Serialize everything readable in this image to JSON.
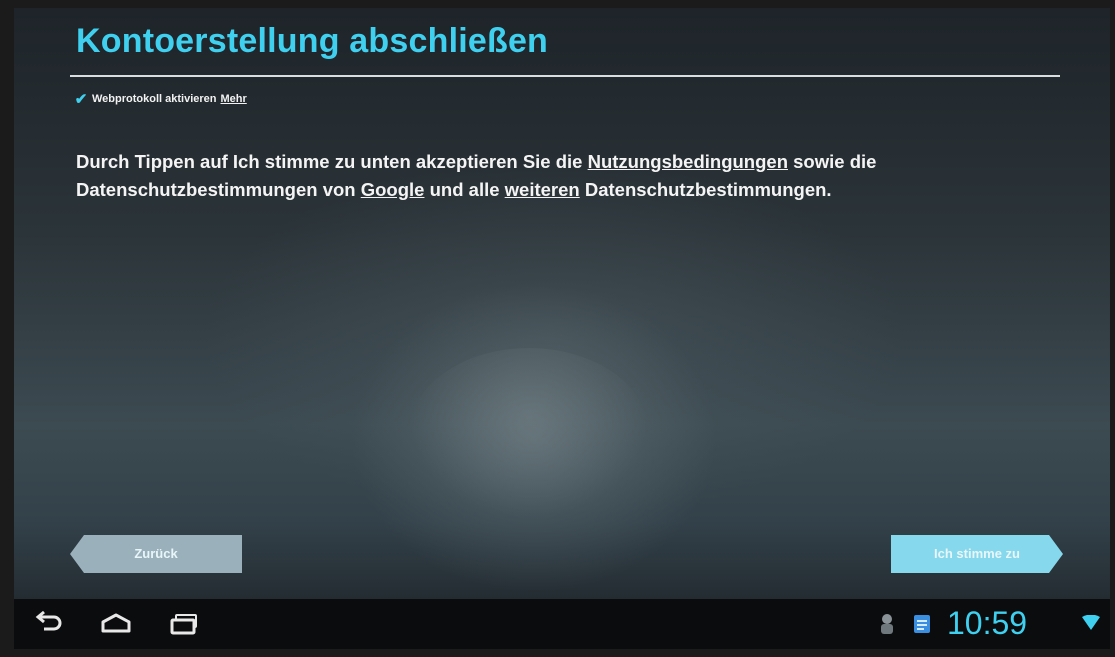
{
  "setup": {
    "title": "Kontoerstellung abschließen",
    "checkbox_label": "Webprotokoll aktivieren",
    "checkbox_link": "Mehr",
    "checkbox_checked": true
  },
  "terms": {
    "part1": "Durch Tippen auf ",
    "bold_phrase": "Ich stimme zu",
    "part2": " unten akzeptieren Sie die ",
    "link_terms": "Nutzungsbedingungen",
    "part3": " sowie die Datenschutzbestimmungen von ",
    "link_google": "Google",
    "part4": " und alle ",
    "link_further": "weiteren",
    "part5": " Datenschutzbestimmungen."
  },
  "buttons": {
    "back_label": "Zurück",
    "agree_label": "Ich stimme zu"
  },
  "status_bar": {
    "time": "10:59",
    "icons": [
      "back-icon",
      "home-icon",
      "recent-apps-icon",
      "android-notification-icon",
      "notification-icon",
      "wifi-icon"
    ]
  },
  "colors": {
    "accent": "#3fd0f0",
    "back_button": "#9ab0bb",
    "agree_button": "#86d8ec"
  }
}
